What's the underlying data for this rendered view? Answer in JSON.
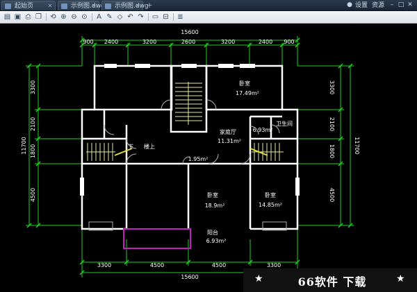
{
  "tabs": [
    {
      "label": "起始页"
    },
    {
      "label": "示例图.dwg"
    },
    {
      "label": "示例图.dwg"
    }
  ],
  "window_controls": {
    "settings": "设置",
    "resources": "资源"
  },
  "toolbar_icons": [
    "open-icon",
    "save-icon",
    "print-icon",
    "copy-icon",
    "zoom-extent-icon",
    "zoom-in-icon",
    "zoom-out-icon",
    "zoom-window-icon",
    "text-icon",
    "pencil-icon",
    "undo-icon",
    "redo-icon",
    "ruler-icon",
    "measure-icon",
    "layers-icon"
  ],
  "plan": {
    "top_total": "15600",
    "top_dims": [
      "900",
      "2400",
      "3200",
      "2600",
      "3200",
      "2400",
      "900"
    ],
    "bottom_dims": [
      "3300",
      "4500",
      "4500",
      "3300"
    ],
    "bottom_total": "15600",
    "left_dims": [
      "3300",
      "2100",
      "1800",
      "4500"
    ],
    "left_total": "11700",
    "right_dims": [
      "3300",
      "2100",
      "1800",
      "4500"
    ],
    "right_total": "11700",
    "rooms": {
      "bedroom_ne": {
        "name": "卧室",
        "area": "17.49m²"
      },
      "living": {
        "name": "家庭厅",
        "area": "11.31m²"
      },
      "small_area": "6.93m²",
      "bathroom": "卫生间",
      "down": "下",
      "upstairs": "楼上",
      "landing_area": "1.95m²",
      "bedroom_s1": {
        "name": "卧室",
        "area": "18.9m²"
      },
      "bedroom_s2": {
        "name": "卧室",
        "area": "14.85m²"
      },
      "balcony": {
        "name": "阳台",
        "area": "6.93m²"
      }
    }
  },
  "watermark": "66软件 下载"
}
